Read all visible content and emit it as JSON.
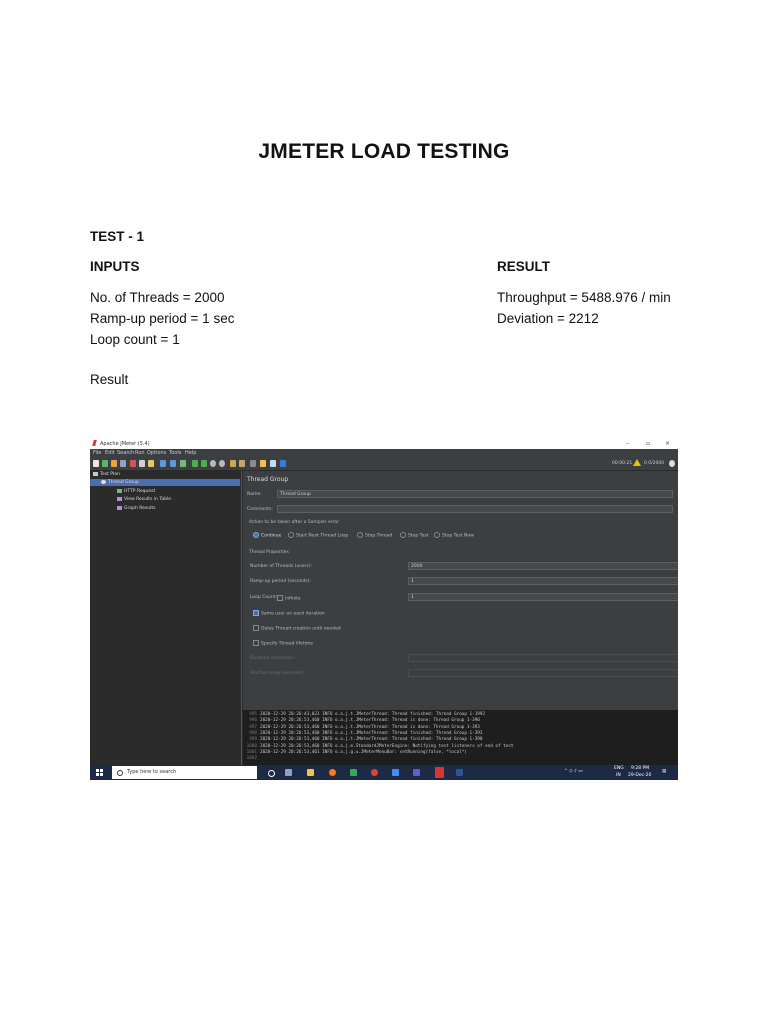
{
  "doc": {
    "title": "JMETER LOAD TESTING",
    "test_label": "TEST - 1",
    "inputs_heading": "INPUTS",
    "result_heading": "RESULT",
    "inputs": [
      "No. of Threads = 2000",
      "Ramp-up period = 1 sec",
      "Loop count = 1"
    ],
    "results": [
      "Throughput = 5488.976 / min",
      "Deviation = 2212"
    ],
    "result_label": "Result"
  },
  "jmeter": {
    "window_title": "Apache JMeter (5.4)",
    "window_controls": [
      "–",
      "▫",
      "×"
    ],
    "menu": [
      "File",
      "Edit",
      "Search",
      "Run",
      "Options",
      "Tools",
      "Help"
    ],
    "toolbar_status": "00:00:21",
    "toolbar_counter": "0  0/2000",
    "tree": {
      "test_plan": "Test Plan",
      "thread_group": "Thread Group",
      "http_request": "HTTP Request",
      "view_results_table": "View Results in Table",
      "graph_results": "Graph Results"
    },
    "panel": {
      "title": "Thread Group",
      "name_label": "Name:",
      "name_value": "Thread Group",
      "comments_label": "Comments:",
      "action_label": "Action to be taken after a Sampler error",
      "actions": [
        "Continue",
        "Start Next Thread Loop",
        "Stop Thread",
        "Stop Test",
        "Stop Test Now"
      ],
      "thread_props_label": "Thread Properties",
      "threads_label": "Number of Threads (users):",
      "threads_value": "2000",
      "rampup_label": "Ramp-up period (seconds):",
      "rampup_value": "1",
      "loop_label": "Loop Count:",
      "infinite_label": "Infinite",
      "loop_value": "1",
      "same_user_label": "Same user on each iteration",
      "delay_label": "Delay Thread creation until needed",
      "lifetime_label": "Specify Thread lifetime",
      "duration_label": "Duration (seconds):",
      "startup_label": "Startup delay (seconds):"
    },
    "log": [
      {
        "n": "995",
        "t": "2020-12-29 20:26:43,023 INFO o.a.j.t.JMeterThread: Thread finished: Thread Group 1-1992"
      },
      {
        "n": "996",
        "t": "2020-12-29 20:26:53,460 INFO o.a.j.t.JMeterThread: Thread is done: Thread Group 1-390"
      },
      {
        "n": "997",
        "t": "2020-12-29 20:26:53,460 INFO o.a.j.t.JMeterThread: Thread is done: Thread Group 1-393"
      },
      {
        "n": "998",
        "t": "2020-12-29 20:26:53,460 INFO o.a.j.t.JMeterThread: Thread finished: Thread Group 1-393"
      },
      {
        "n": "999",
        "t": "2020-12-29 20:26:53,460 INFO o.a.j.t.JMeterThread: Thread finished: Thread Group 1-390"
      },
      {
        "n": "1000",
        "t": "2020-12-29 20:26:53,460 INFO o.a.j.e.StandardJMeterEngine: Notifying test listeners of end of test"
      },
      {
        "n": "1001",
        "t": "2020-12-29 20:26:53,461 INFO o.a.j.g.u.JMeterMenuBar: setRunning(false, *local*)"
      },
      {
        "n": "1002",
        "t": ""
      }
    ],
    "taskbar": {
      "search_placeholder": "Type here to search",
      "lang": "ENG",
      "region": "IN",
      "time": "9:28 PM",
      "date": "29-Dec-20"
    }
  }
}
